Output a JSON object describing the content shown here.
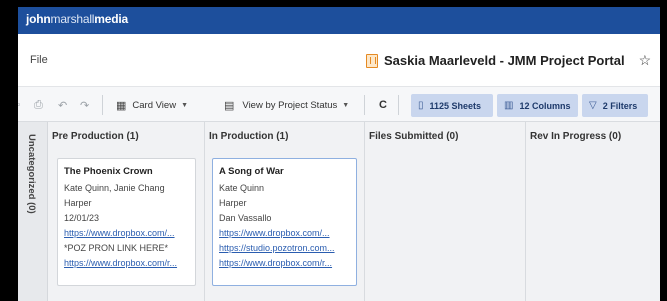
{
  "brand": {
    "bold": "john",
    "thin": "marshall",
    "bold2": "media"
  },
  "menu": {
    "file": "File"
  },
  "portal": {
    "title": "Saskia Maarleveld - JMM Project Portal",
    "star": "☆"
  },
  "toolbar": {
    "icons": [
      "print-icon",
      "undo-icon",
      "redo-icon"
    ],
    "card_view": "Card View",
    "view_by": "View by Project Status",
    "refresh": "C",
    "sheets": "1125 Sheets",
    "columns": "12 Columns",
    "filters": "2 Filters"
  },
  "lane": {
    "label": "Uncategorized (0)"
  },
  "columns": [
    {
      "title": "Pre Production (1)"
    },
    {
      "title": "In Production (1)"
    },
    {
      "title": "Files Submitted (0)"
    },
    {
      "title": "Rev In Progress (0)"
    }
  ],
  "cards": [
    {
      "title": "The Phoenix Crown",
      "lines": [
        "Kate Quinn, Janie Chang",
        "Harper",
        "12/01/23"
      ],
      "links": [
        "https://www.dropbox.com/...",
        "*POZ PRON LINK HERE*",
        "https://www.dropbox.com/r..."
      ]
    },
    {
      "title": "A Song of War",
      "lines": [
        "Kate Quinn",
        "Harper",
        "Dan Vassallo"
      ],
      "links": [
        "https://www.dropbox.com/...",
        "https://studio.pozotron.com...",
        "https://www.dropbox.com/r..."
      ]
    }
  ],
  "colors": {
    "brandbar": "#1d4f9c",
    "chip": "#c9d6ee",
    "link": "#2a5db0",
    "portal_icon": "#e58a23"
  }
}
